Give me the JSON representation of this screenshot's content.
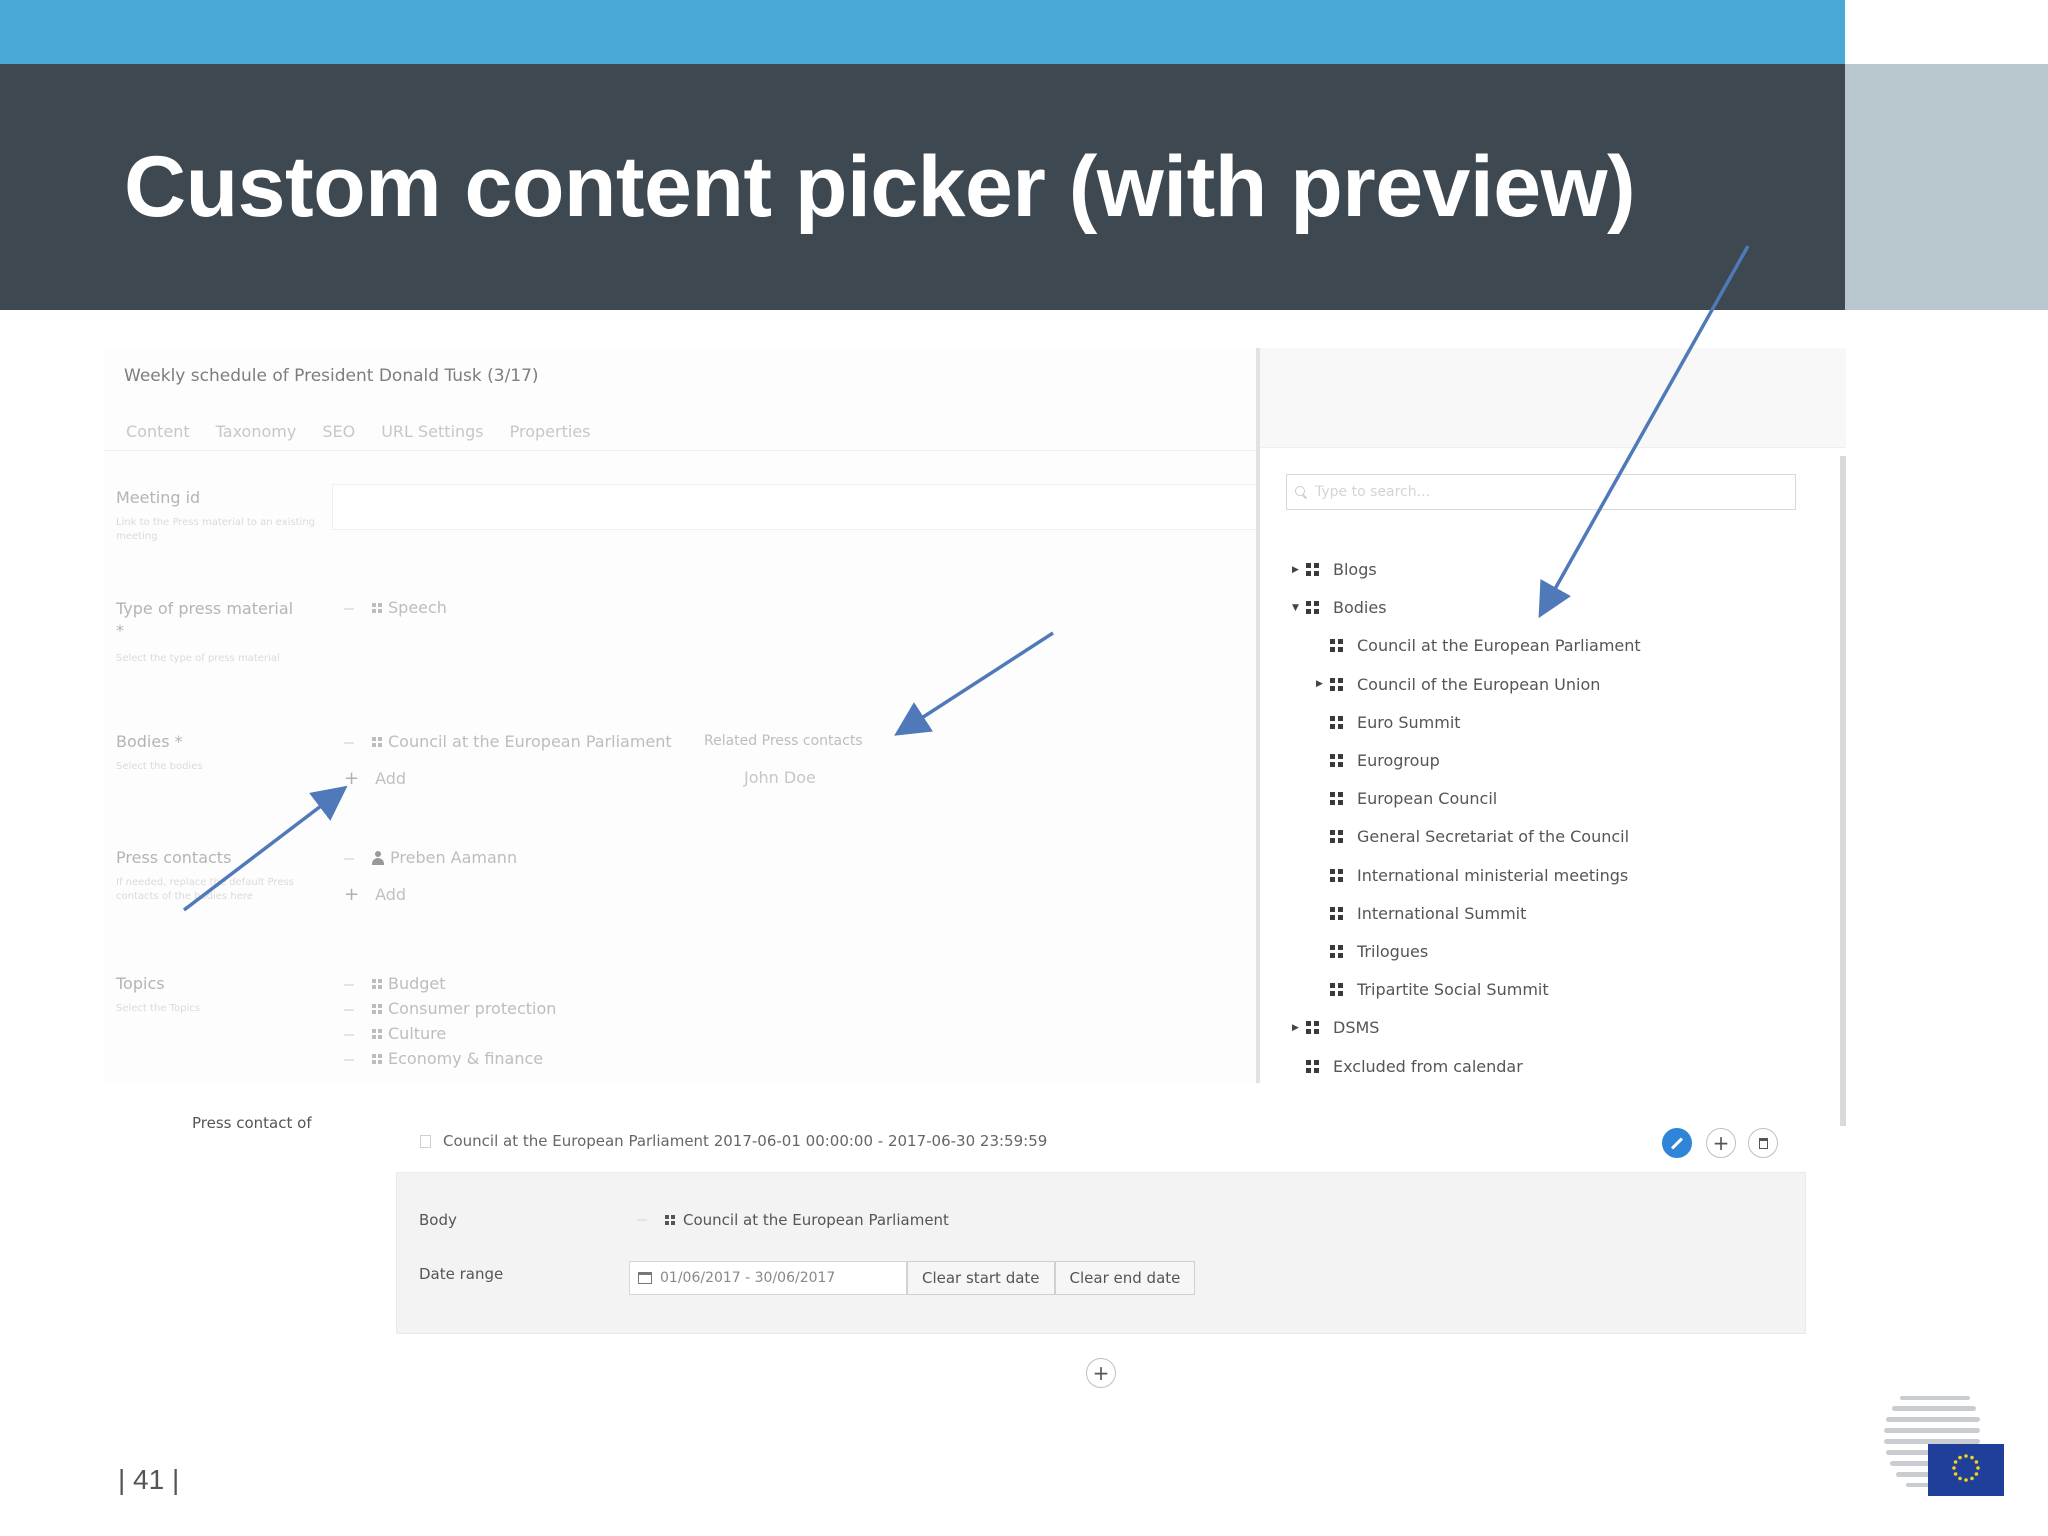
{
  "slide": {
    "title": "Custom content picker (with preview)",
    "page_number": "| 41 |",
    "colors": {
      "top_bar": "#4aa8d6",
      "title_band": "#3d4851",
      "side_block": "#b8c7cd",
      "arrow": "#4f79b8"
    }
  },
  "editor": {
    "doc_title": "Weekly schedule of President Donald Tusk (3/17)",
    "tabs": [
      "Content",
      "Taxonomy",
      "SEO",
      "URL Settings",
      "Properties"
    ],
    "fields": {
      "meeting_id": {
        "label": "Meeting id",
        "help": "Link to the Press material to an existing meeting"
      },
      "press_type": {
        "label": "Type of press material *",
        "help": "Select the type of press material",
        "value": "Speech"
      },
      "bodies": {
        "label": "Bodies *",
        "help": "Select the bodies",
        "value": "Council at the European Parliament",
        "add": "Add"
      },
      "related": {
        "label": "Related Press contacts",
        "value": "John Doe"
      },
      "press_contacts": {
        "label": "Press contacts",
        "help": "If needed, replace the default Press contacts of the bodies here",
        "value": "Preben Aamann",
        "add": "Add"
      },
      "topics": {
        "label": "Topics",
        "help": "Select the Topics",
        "values": [
          "Budget",
          "Consumer protection",
          "Culture",
          "Economy & finance"
        ]
      }
    }
  },
  "picker": {
    "search_placeholder": "Type to search...",
    "tree": [
      {
        "label": "Blogs",
        "level": 0,
        "caret": "right"
      },
      {
        "label": "Bodies",
        "level": 0,
        "caret": "down"
      },
      {
        "label": "Council at the European Parliament",
        "level": 1,
        "caret": ""
      },
      {
        "label": "Council of the European Union",
        "level": 1,
        "caret": "right"
      },
      {
        "label": "Euro Summit",
        "level": 1,
        "caret": ""
      },
      {
        "label": "Eurogroup",
        "level": 1,
        "caret": ""
      },
      {
        "label": "European Council",
        "level": 1,
        "caret": ""
      },
      {
        "label": "General Secretariat of the Council",
        "level": 1,
        "caret": ""
      },
      {
        "label": "International ministerial meetings",
        "level": 1,
        "caret": ""
      },
      {
        "label": "International Summit",
        "level": 1,
        "caret": ""
      },
      {
        "label": "Trilogues",
        "level": 1,
        "caret": ""
      },
      {
        "label": "Tripartite Social Summit",
        "level": 1,
        "caret": ""
      },
      {
        "label": "DSMS",
        "level": 0,
        "caret": "right"
      },
      {
        "label": "Excluded from calendar",
        "level": 0,
        "caret": ""
      }
    ]
  },
  "press_contact_of": {
    "label": "Press contact of",
    "row_text": "Council at the European Parliament 2017-06-01 00:00:00 - 2017-06-30 23:59:59",
    "body_label": "Body",
    "body_value": "Council at the European Parliament",
    "date_label": "Date range",
    "date_value": "01/06/2017 - 30/06/2017",
    "clear_start": "Clear start date",
    "clear_end": "Clear end date"
  }
}
